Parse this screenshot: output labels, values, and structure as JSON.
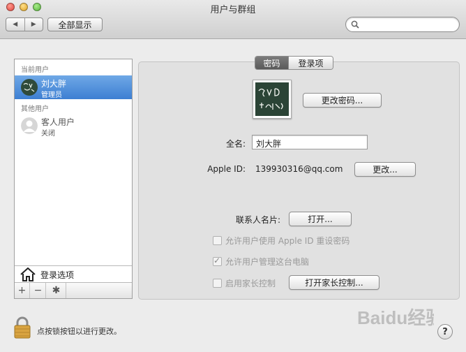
{
  "window": {
    "title": "用户与群组"
  },
  "toolbar": {
    "back_glyph": "◀",
    "forward_glyph": "▶",
    "show_all_label": "全部显示",
    "search_placeholder": ""
  },
  "sidebar": {
    "current_users_header": "当前用户",
    "other_users_header": "其他用户",
    "users": [
      {
        "name": "刘大胖",
        "role": "管理员",
        "selected": true
      },
      {
        "name": "客人用户",
        "role": "关闭",
        "selected": false
      }
    ],
    "login_options_label": "登录选项",
    "add_glyph": "+",
    "remove_glyph": "−",
    "gear_glyph": "✱"
  },
  "tabs": [
    {
      "label": "密码",
      "active": true
    },
    {
      "label": "登录项",
      "active": false
    }
  ],
  "form": {
    "change_password_label": "更改密码...",
    "full_name_label": "全名:",
    "full_name_value": "刘大胖",
    "apple_id_label": "Apple ID:",
    "apple_id_value": "139930316@qq.com",
    "change_apple_id_label": "更改...",
    "contact_card_label": "联系人名片:",
    "open_contact_label": "打开...",
    "allow_reset_label": "允许用户使用 Apple ID 重设密码",
    "allow_admin_label": "允许用户管理这台电脑",
    "parental_label": "启用家长控制",
    "open_parental_label": "打开家长控制..."
  },
  "footer": {
    "lock_text": "点按锁按钮以进行更改。",
    "help_glyph": "?"
  },
  "watermark": {
    "text": "Baidu经验"
  },
  "colors": {
    "selection": "#3d7fd2",
    "panel_bg": "#e1e1e1",
    "window_bg": "#ececec"
  }
}
